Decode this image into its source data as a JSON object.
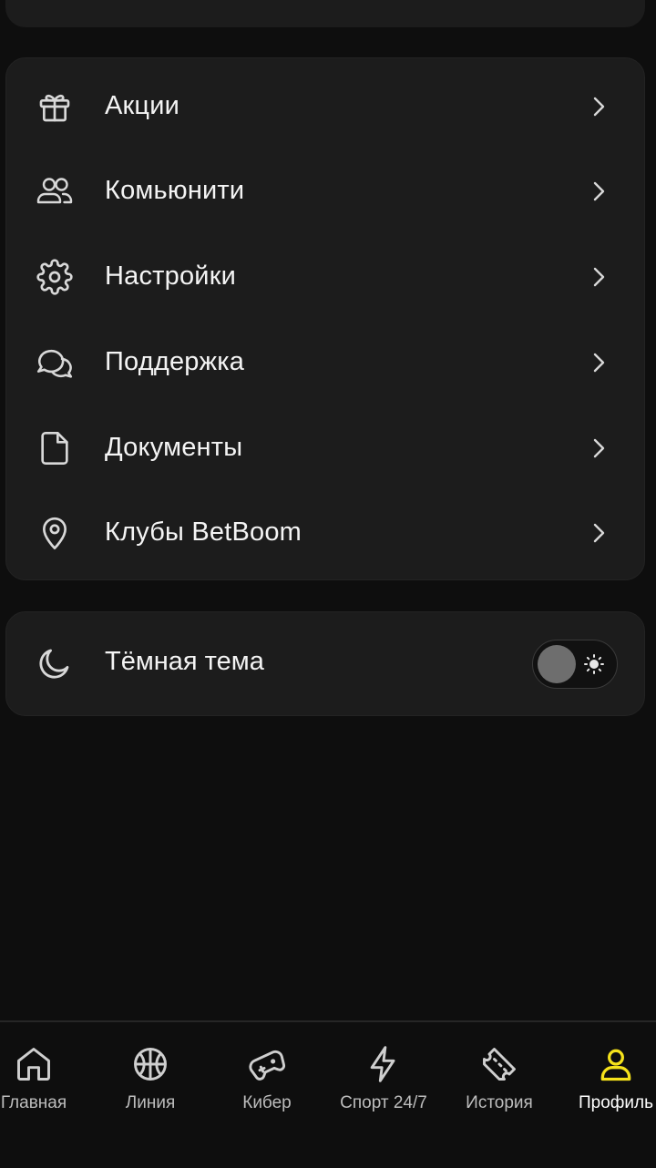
{
  "menu": {
    "items": [
      {
        "label": "Акции",
        "icon": "gift-icon"
      },
      {
        "label": "Комьюнити",
        "icon": "users-icon"
      },
      {
        "label": "Настройки",
        "icon": "gear-icon"
      },
      {
        "label": "Поддержка",
        "icon": "chat-bubbles-icon"
      },
      {
        "label": "Документы",
        "icon": "document-icon"
      },
      {
        "label": "Клубы BetBoom",
        "icon": "location-pin-icon"
      }
    ]
  },
  "theme": {
    "label": "Тёмная тема",
    "icon": "moon-icon",
    "toggle_on": false
  },
  "bottom_nav": {
    "items": [
      {
        "label": "Главная",
        "icon": "home-icon",
        "active": false
      },
      {
        "label": "Линия",
        "icon": "basketball-icon",
        "active": false
      },
      {
        "label": "Кибер",
        "icon": "gamepad-icon",
        "active": false
      },
      {
        "label": "Спорт 24/7",
        "icon": "lightning-icon",
        "active": false
      },
      {
        "label": "История",
        "icon": "ticket-icon",
        "active": false
      },
      {
        "label": "Профиль",
        "icon": "user-icon",
        "active": true
      }
    ],
    "active_color": "#f5e21b",
    "inactive_color": "#bdbdbd"
  }
}
